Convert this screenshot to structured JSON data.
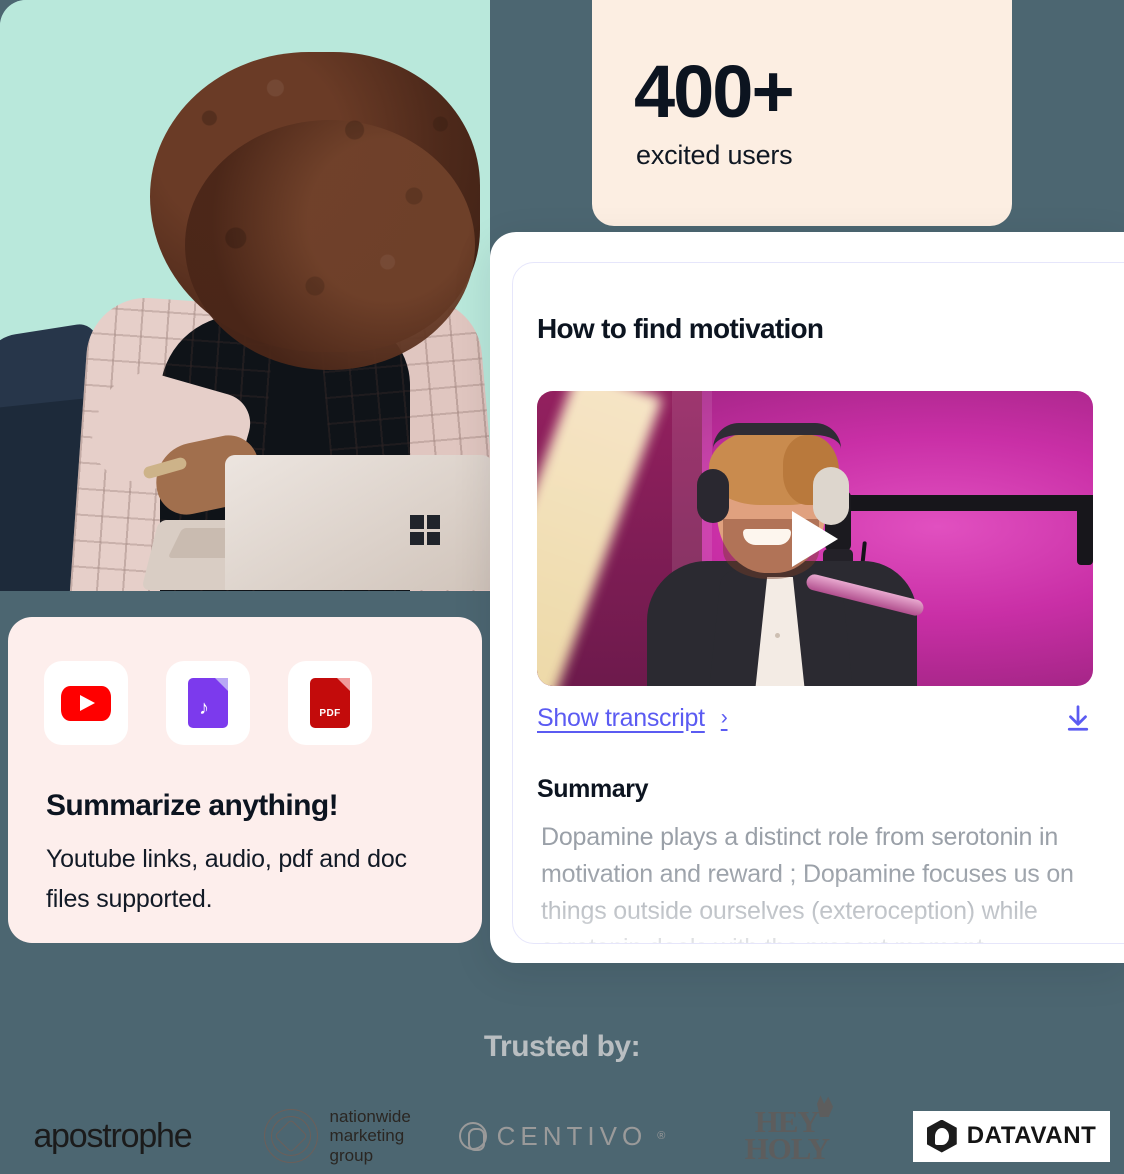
{
  "theme": {
    "page_background": "#4c6671",
    "cream_card": "#fceee2",
    "teal_panel": "#b8e8da",
    "pink_card": "#fdeeec",
    "white_card": "#ffffff",
    "link_accent": "#5b5bf2",
    "text_dark": "#0c1420",
    "muted_text": "#9aa0a8",
    "trusted_label": "#b9bec1"
  },
  "photo_panel": {
    "name": "woman-laptop-photo",
    "alt": "Smiling woman with curly hair using a laptop",
    "laptop_badge_icon": "windows-logo-icon"
  },
  "stat_card": {
    "number": "400+",
    "label": "excited users"
  },
  "summarize_card": {
    "heading": "Summarize anything!",
    "description": "Youtube links, audio, pdf and doc files supported.",
    "tiles": [
      {
        "icon": "youtube-icon",
        "label": "YouTube"
      },
      {
        "icon": "audio-file-icon",
        "label": "Audio file",
        "glyph": "♪"
      },
      {
        "icon": "pdf-file-icon",
        "label": "PDF file",
        "glyph": "PDF"
      }
    ]
  },
  "summary_card": {
    "title": "How to find motivation",
    "thumbnail": {
      "name": "video-thumbnail",
      "alt": "Man with headphones smiling in front of a microphone on a pink backdrop",
      "play_icon": "play-icon"
    },
    "transcript_link": "Show transcript",
    "transcript_chevron": "›",
    "download_icon": "download-icon",
    "summary_heading": "Summary",
    "summary_text": "Dopamine plays a distinct role from serotonin in motivation and reward ; Dopamine focuses us on things outside ourselves (exteroception) while serotonin deals with the present moment"
  },
  "trusted": {
    "label": "Trusted by:",
    "logos": [
      {
        "name": "apostrophe",
        "text": "apostrophe"
      },
      {
        "name": "nationwide-marketing-group",
        "line1": "nationwide",
        "line2": "marketing",
        "line3": "group"
      },
      {
        "name": "centivo",
        "text": "CENTIVO",
        "mark": "®"
      },
      {
        "name": "hey-holy",
        "line1": "HEY",
        "line2": "HOLY"
      },
      {
        "name": "datavant",
        "text": "DATAVANT"
      }
    ]
  }
}
